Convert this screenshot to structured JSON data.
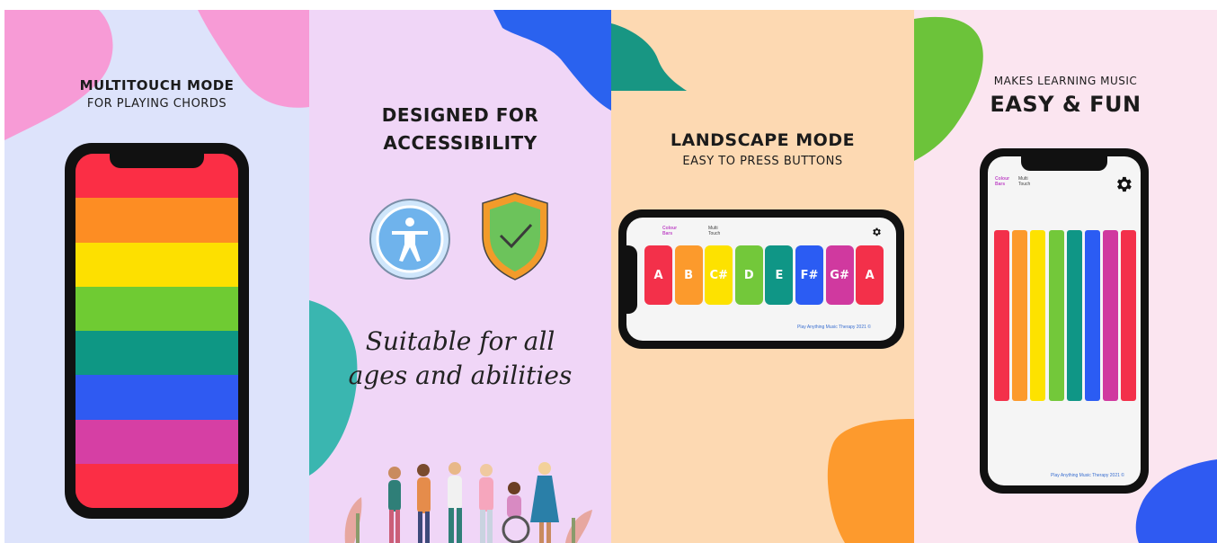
{
  "panel1": {
    "title": "MULTITOUCH MODE",
    "subtitle": "FOR PLAYING CHORDS",
    "bands": [
      "#fb2e45",
      "#fd8d23",
      "#fde000",
      "#6fcb33",
      "#0e9784",
      "#2f5af2",
      "#d63fa4",
      "#fb2e45"
    ]
  },
  "panel2": {
    "title_line1": "DESIGNED FOR",
    "title_line2": "ACCESSIBILITY",
    "script_line1": "Suitable for all",
    "script_line2": "ages and abilities"
  },
  "panel3": {
    "title": "LANDSCAPE MODE",
    "subtitle": "EASY TO PRESS BUTTONS",
    "tab_colour_bars": "Colour Bars",
    "tab_multi_touch": "Multi Touch",
    "footer": "Play Anything Music Therapy  2021 ©",
    "keys": [
      {
        "label": "A",
        "color": "#f3304a"
      },
      {
        "label": "B",
        "color": "#fc9a2c"
      },
      {
        "label": "C#",
        "color": "#fde200"
      },
      {
        "label": "D",
        "color": "#73c83a"
      },
      {
        "label": "E",
        "color": "#0f9686"
      },
      {
        "label": "F#",
        "color": "#2b5cf3"
      },
      {
        "label": "G#",
        "color": "#d0399f"
      },
      {
        "label": "A",
        "color": "#f3304a"
      }
    ]
  },
  "panel4": {
    "title_small": "MAKES LEARNING MUSIC",
    "title_big": "EASY & FUN",
    "tab_colour_bars": "Colour Bars",
    "tab_multi_touch": "Multi Touch",
    "footer": "Play Anything Music Therapy  2021 ©",
    "bars": [
      "#f3304a",
      "#fc9a2c",
      "#fde200",
      "#73c83a",
      "#0f9686",
      "#2b5cf3",
      "#d0399f",
      "#f3304a"
    ]
  },
  "icons": {
    "settings": "gear-icon",
    "accessibility": "accessibility-person-icon",
    "shield": "shield-check-icon"
  }
}
